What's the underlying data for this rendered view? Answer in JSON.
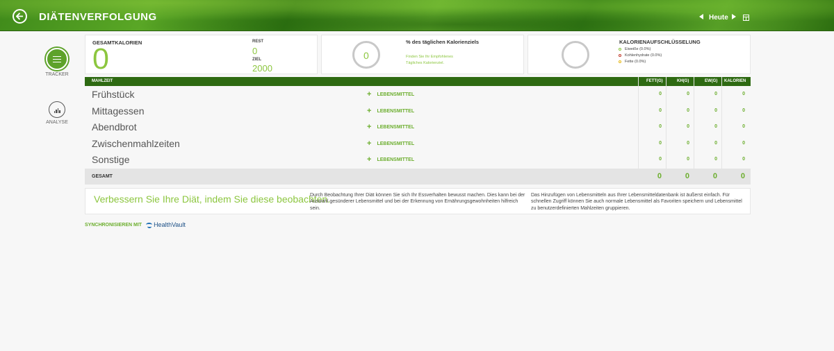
{
  "header": {
    "title": "DIÄTENVERFOLGUNG",
    "date_label": "Heute"
  },
  "sidebar": {
    "items": [
      {
        "label": "TRACKER",
        "icon": "list-icon",
        "active": true
      },
      {
        "label": "ANALYSE",
        "icon": "bar-chart-icon",
        "active": false
      }
    ]
  },
  "summary": {
    "total_label": "GESAMTKALORIEN",
    "total_value": "0",
    "rest_label": "REST",
    "rest_value": "0",
    "goal_label": "ZIEL",
    "goal_value": "2000",
    "daily_ring_value": "0",
    "daily_title": "% des täglichen Kalorienziels",
    "daily_subtitle": "Finden Sie Ihr Empfohlenes Tägliches Kalorienziel.",
    "breakdown_title": "KALORIENAUFSCHLÜSSELUNG",
    "breakdown_items": [
      {
        "label": "Eiweiße (0.0%)",
        "color": "#8cc63f"
      },
      {
        "label": "Kohlenhydrate (0.0%)",
        "color": "#c0392b"
      },
      {
        "label": "Fette (0.0%)",
        "color": "#e5b817"
      }
    ]
  },
  "table": {
    "columns": [
      "MAHLZEIT",
      "FETT(g)",
      "KH(g)",
      "EW(g)",
      "KALORIEN"
    ],
    "add_label": "LEBENSMITTEL",
    "meals": [
      {
        "name": "Frühstück",
        "values": [
          "0",
          "0",
          "0",
          "0"
        ]
      },
      {
        "name": "Mittagessen",
        "values": [
          "0",
          "0",
          "0",
          "0"
        ]
      },
      {
        "name": "Abendbrot",
        "values": [
          "0",
          "0",
          "0",
          "0"
        ]
      },
      {
        "name": "Zwischenmahlzeiten",
        "values": [
          "0",
          "0",
          "0",
          "0"
        ]
      },
      {
        "name": "Sonstige",
        "values": [
          "0",
          "0",
          "0",
          "0"
        ]
      }
    ],
    "total_label": "GESAMT",
    "totals": [
      "0",
      "0",
      "0",
      "0"
    ]
  },
  "tips": {
    "heading": "Verbessern Sie Ihre Diät, indem Sie diese beobachten.",
    "text_1": "Durch Beobachtung Ihrer Diät können Sie sich Ihr Essverhalten bewusst machen. Dies kann bei der Auswahl gesünderer Lebensmittel und bei der Erkennung von Ernährungsgewohnheiten hilfreich sein.",
    "text_2": "Das Hinzufügen von Lebensmitteln aus Ihrer Lebensmitteldatenbank ist äußerst einfach. Für schnellen Zugriff können Sie auch normale Lebensmittel als Favoriten speichern und Lebensmittel zu benutzerdefinierten Mahlzeiten gruppieren."
  },
  "sync": {
    "label": "SYNCHRONISIEREN MIT",
    "service": "HealthVault"
  },
  "colors": {
    "accent": "#8cc63f",
    "header_dark": "#2e6a12"
  }
}
